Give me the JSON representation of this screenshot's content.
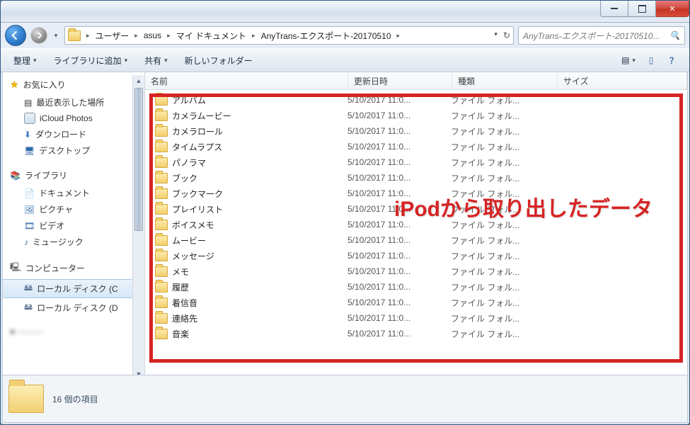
{
  "window_controls": {
    "minimize": "_",
    "maximize": "□",
    "close": "✕"
  },
  "breadcrumbs": [
    "ユーザー",
    "asus",
    "マイ ドキュメント",
    "AnyTrans-エクスポート-20170510"
  ],
  "search_placeholder": "AnyTrans-エクスポート-20170510...",
  "toolbar": {
    "organize": "整理",
    "add_to_library": "ライブラリに追加",
    "share": "共有",
    "new_folder": "新しいフォルダー"
  },
  "columns": {
    "name": "名前",
    "date": "更新日時",
    "type": "種類",
    "size": "サイズ"
  },
  "sidebar": {
    "favorites": {
      "title": "お気に入り",
      "items": [
        "最近表示した場所",
        "iCloud Photos",
        "ダウンロード",
        "デスクトップ"
      ]
    },
    "libraries": {
      "title": "ライブラリ",
      "items": [
        "ドキュメント",
        "ピクチャ",
        "ビデオ",
        "ミュージック"
      ]
    },
    "computer": {
      "title": "コンピューター",
      "items": [
        "ローカル ディスク (C",
        "ローカル ディスク (D"
      ]
    }
  },
  "files": [
    {
      "name": "アルバム",
      "date": "5/10/2017 11:0...",
      "type": "ファイル フォル..."
    },
    {
      "name": "カメラムービー",
      "date": "5/10/2017 11:0...",
      "type": "ファイル フォル..."
    },
    {
      "name": "カメラロール",
      "date": "5/10/2017 11:0...",
      "type": "ファイル フォル..."
    },
    {
      "name": "タイムラプス",
      "date": "5/10/2017 11:0...",
      "type": "ファイル フォル..."
    },
    {
      "name": "パノラマ",
      "date": "5/10/2017 11:0...",
      "type": "ファイル フォル..."
    },
    {
      "name": "ブック",
      "date": "5/10/2017 11:0...",
      "type": "ファイル フォル..."
    },
    {
      "name": "ブックマーク",
      "date": "5/10/2017 11:0...",
      "type": "ファイル フォル..."
    },
    {
      "name": "プレイリスト",
      "date": "5/10/2017 11:0...",
      "type": "ファイル フォル..."
    },
    {
      "name": "ボイスメモ",
      "date": "5/10/2017 11:0...",
      "type": "ファイル フォル..."
    },
    {
      "name": "ムービー",
      "date": "5/10/2017 11:0...",
      "type": "ファイル フォル..."
    },
    {
      "name": "メッセージ",
      "date": "5/10/2017 11:0...",
      "type": "ファイル フォル..."
    },
    {
      "name": "メモ",
      "date": "5/10/2017 11:0...",
      "type": "ファイル フォル..."
    },
    {
      "name": "履歴",
      "date": "5/10/2017 11:0...",
      "type": "ファイル フォル..."
    },
    {
      "name": "着信音",
      "date": "5/10/2017 11:0...",
      "type": "ファイル フォル..."
    },
    {
      "name": "連絡先",
      "date": "5/10/2017 11:0...",
      "type": "ファイル フォル..."
    },
    {
      "name": "音楽",
      "date": "5/10/2017 11:0...",
      "type": "ファイル フォル..."
    }
  ],
  "overlay": "iPodから取り出したデータ",
  "status": "16 個の項目"
}
